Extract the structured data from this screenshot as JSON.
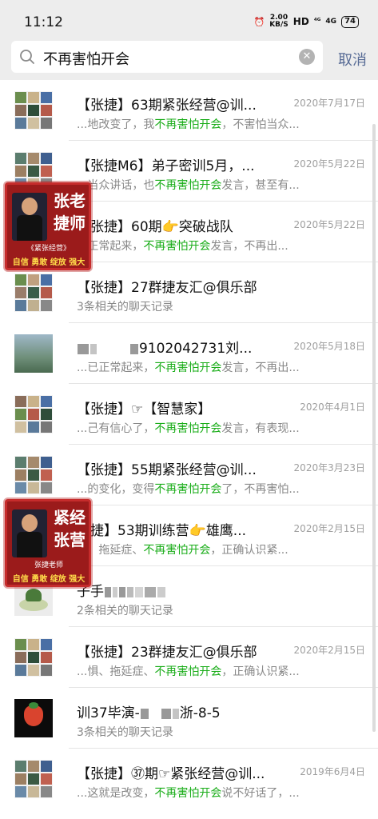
{
  "status": {
    "time": "11:12",
    "net_speed_top": "2.00",
    "net_speed_unit": "KB/S",
    "hd": "HD",
    "sig1": "⁴ᴳ",
    "sig2": "4G",
    "battery": "74"
  },
  "search": {
    "query": "不再害怕开会",
    "cancel_label": "取消"
  },
  "results": [
    {
      "title": "【张捷】63期紧张经营@训...",
      "date": "2020年7月17日",
      "pre": "...地改变了，我",
      "hl": "不再害怕开会",
      "post": "，不害怕当众..."
    },
    {
      "title": "【张捷M6】弟子密训5月，...",
      "date": "2020年5月22日",
      "pre": "...当众讲话，也",
      "hl": "不再害怕开会",
      "post": "发言，甚至有..."
    },
    {
      "title": "【张捷】60期👉突破战队",
      "date": "2020年5月22日",
      "pre": "...正常起来，",
      "hl": "不再害怕开会",
      "post": "发言，不再出..."
    },
    {
      "title": "【张捷】27群捷友汇@俱乐部",
      "date": "",
      "pre": "3条相关的聊天记录",
      "hl": "",
      "post": ""
    },
    {
      "title": "9102042731刘...",
      "date": "2020年5月18日",
      "pre": "...已正常起来，",
      "hl": "不再害怕开会",
      "post": "发言，不再出..."
    },
    {
      "title": "【张捷】☞【智慧家】",
      "date": "2020年4月1日",
      "pre": "...己有信心了，",
      "hl": "不再害怕开会",
      "post": "发言，有表现..."
    },
    {
      "title": "【张捷】55期紧张经营@训...",
      "date": "2020年3月23日",
      "pre": "...的变化，变得",
      "hl": "不再害怕开会",
      "post": "了，不再害怕..."
    },
    {
      "title": "张捷】53期训练营👉雄鹰...",
      "date": "2020年2月15日",
      "pre": "...、拖延症、",
      "hl": "不再害怕开会",
      "post": "，正确认识紧..."
    },
    {
      "title": "子手",
      "date": "",
      "pre": "2条相关的聊天记录",
      "hl": "",
      "post": ""
    },
    {
      "title": "【张捷】23群捷友汇@俱乐部",
      "date": "2020年2月15日",
      "pre": "...惧、拖延症、",
      "hl": "不再害怕开会",
      "post": "，正确认识紧..."
    },
    {
      "title": "训37毕演-",
      "date": "",
      "pre": "3条相关的聊天记录",
      "hl": "",
      "post": ""
    },
    {
      "title": "【张捷】㊲期☞紧张经营@训...",
      "date": "2019年6月4日",
      "pre": "...这就是改变，",
      "hl": "不再害怕开会",
      "post": "说不好话了，..."
    }
  ],
  "title_tail_row10": "浙-8-5",
  "stickers": [
    {
      "big": "张老捷师",
      "sub": "《紧张经营》",
      "motto": "自信 勇敢 绽放 强大"
    },
    {
      "big": "紧经张营",
      "sub": "张捷老师",
      "motto": "自信 勇敢 绽放 强大"
    }
  ],
  "colors": {
    "highlight": "#1aad19",
    "cancel": "#576b95",
    "sticker_red": "#9b1b1b"
  }
}
